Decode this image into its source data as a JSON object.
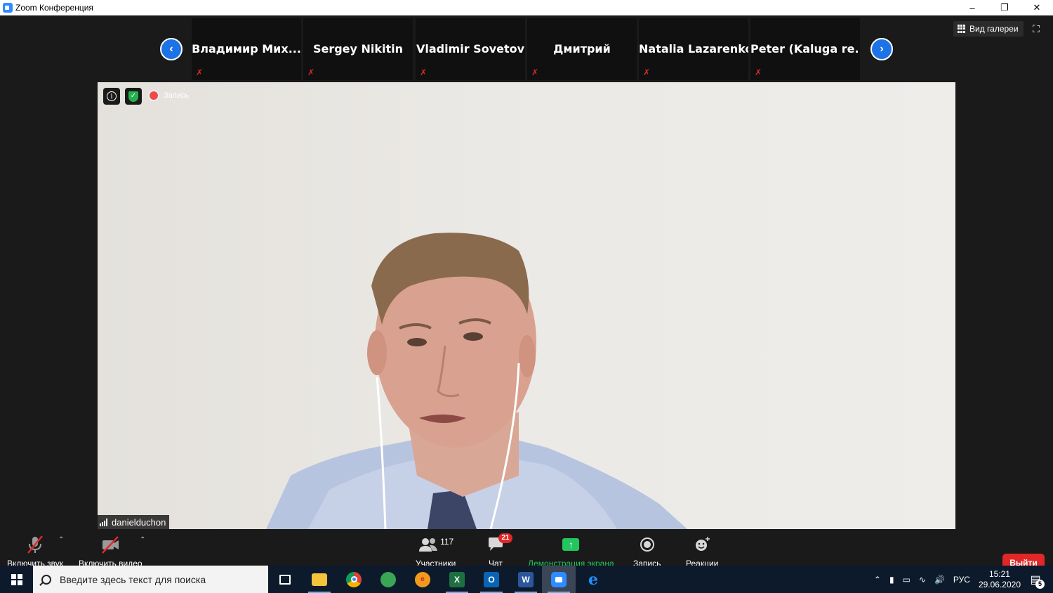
{
  "window": {
    "title": "Zoom Конференция",
    "minimize": "–",
    "restore": "❐",
    "close": "✕"
  },
  "gallery": {
    "label": "Вид галереи"
  },
  "participants_strip": [
    {
      "name": "Владимир  Мих...",
      "muted": true
    },
    {
      "name": "Sergey Nikitin",
      "muted": true
    },
    {
      "name": "Vladimir Sovetov",
      "muted": true
    },
    {
      "name": "Дмитрий",
      "muted": true
    },
    {
      "name": "Natalia Lazarenko",
      "muted": true
    },
    {
      "name": "Peter  (Kaluga  re...",
      "muted": true
    }
  ],
  "video": {
    "recording_label": "Запись",
    "speaker_name": "danielduchon"
  },
  "toolbar": {
    "audio_label": "Включить звук",
    "video_label": "Включить видео",
    "participants_label": "Участники",
    "participants_count": "117",
    "chat_label": "Чат",
    "chat_badge": "21",
    "share_label": "Демонстрация экрана",
    "record_label": "Запись",
    "reactions_label": "Реакции",
    "exit_label": "Выйти"
  },
  "taskbar": {
    "search_placeholder": "Введите здесь текст для поиска",
    "language": "РУС",
    "time": "15:21",
    "date": "29.06.2020",
    "notification_count": "5",
    "apps": [
      "task-view",
      "file-explorer",
      "chrome",
      "maps",
      "gpn",
      "excel",
      "outlook",
      "word",
      "zoom",
      "edge"
    ]
  },
  "colors": {
    "zoom_blue": "#2d8cff",
    "nav_blue": "#1c73e8",
    "mute_red": "#e02828",
    "share_green": "#22c55e",
    "exit_red": "#e02828",
    "taskbar_bg": "#0d1a2c"
  }
}
